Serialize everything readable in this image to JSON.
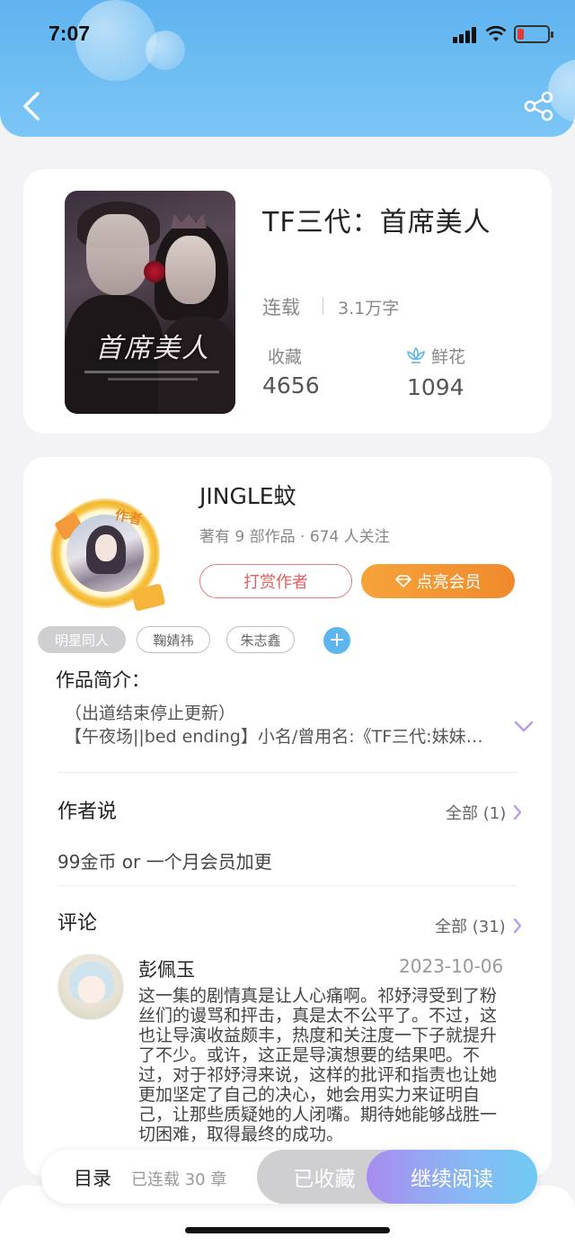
{
  "status_bar": {
    "time": "7:07"
  },
  "header": {
    "back_icon": "chevron-left-icon",
    "share_icon": "share-icon"
  },
  "book": {
    "title": "TF三代：首席美人",
    "status": "连载",
    "word_count": "3.1万字",
    "favorites_label": "收藏",
    "favorites_value": "4656",
    "flowers_label": "鲜花",
    "flowers_value": "1094",
    "cover_text": "首席美人"
  },
  "author": {
    "name": "JINGLE蚊",
    "meta": "著有 9 部作品 · 674 人关注",
    "badge": "作者",
    "reward_label": "打赏作者",
    "vip_label": "点亮会员"
  },
  "tags": [
    "明星同人",
    "鞠婧祎",
    "朱志鑫"
  ],
  "intro": {
    "title": "作品简介：",
    "line1": "（出道结束停止更新）",
    "line2": "【午夜场||bed ending】小名/曾用名:《TF三代:妹妹是女团成员》"
  },
  "author_says": {
    "title": "作者说",
    "all_label": "全部 (1)",
    "text": "99金币 or 一个月会员加更"
  },
  "comments": {
    "title": "评论",
    "all_label": "全部 (31)",
    "items": [
      {
        "name": "彭佩玉",
        "date": "2023-10-06",
        "body": "这一集的剧情真是让人心痛啊。祁妤浔受到了粉丝们的谩骂和抨击，真是太不公平了。不过，这也让导演收益颇丰，热度和关注度一下子就提升了不少。或许，这正是导演想要的结果吧。不过，对于祁妤浔来说，这样的批评和指责也让她更加坚定了自己的决心，她会用实力来证明自己，让那些质疑她的人闭嘴。期待她能够战胜一切困难，取得最终的成功。"
      }
    ]
  },
  "bottom_bar": {
    "toc_label": "目录",
    "toc_count": "已连载 30 章",
    "saved_label": "已收藏",
    "read_label": "继续阅读"
  },
  "colors": {
    "header": "#6bbbf2",
    "accent_orange": "#f39533",
    "reward_red": "#e26060",
    "tag_add": "#5fb6ef",
    "read_gradient_start": "#a88cf0",
    "read_gradient_end": "#6fcaf3"
  }
}
